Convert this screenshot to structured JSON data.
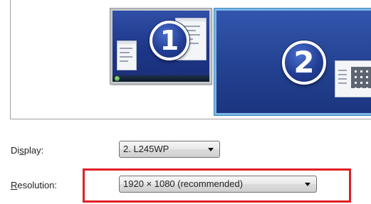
{
  "monitors": [
    {
      "number": "1"
    },
    {
      "number": "2"
    }
  ],
  "display": {
    "label_pre": "Di",
    "label_accel": "s",
    "label_post": "play:",
    "value": "2. L245WP"
  },
  "resolution": {
    "label_accel": "R",
    "label_post": "esolution:",
    "value": "1920 × 1080 (recommended)"
  },
  "highlight_color": "#e01f26",
  "selected_monitor_border_color": "#7ab6e4"
}
